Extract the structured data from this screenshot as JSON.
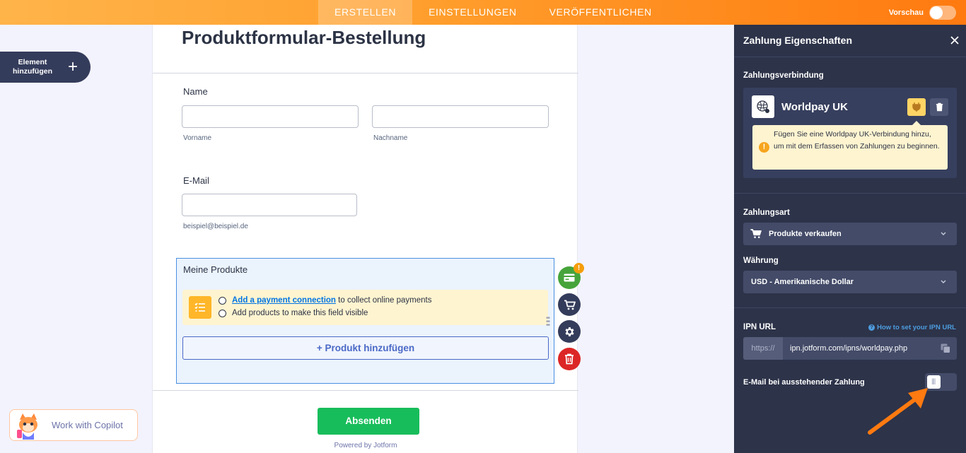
{
  "topbar": {
    "tabs": [
      {
        "label": "ERSTELLEN",
        "active": true
      },
      {
        "label": "EINSTELLUNGEN",
        "active": false
      },
      {
        "label": "VERÖFFENTLICHEN",
        "active": false
      }
    ],
    "preview_label": "Vorschau"
  },
  "sidebar": {
    "add_element_label": "Element hinzufügen"
  },
  "form": {
    "title": "Produktformular-Bestellung",
    "name_label": "Name",
    "firstname_sublabel": "Vorname",
    "lastname_sublabel": "Nachname",
    "email_label": "E-Mail",
    "email_sublabel": "beispiel@beispiel.de",
    "products": {
      "title": "Meine Produkte",
      "notice_link": "Add a payment connection",
      "notice_line1_rest": " to collect online payments",
      "notice_line2": "Add products to make this field visible",
      "add_button": "+ Produkt hinzufügen",
      "badge": "!"
    },
    "submit_label": "Absenden",
    "powered_by": "Powered by Jotform"
  },
  "copilot": {
    "label": "Work with Copilot"
  },
  "panel": {
    "title": "Zahlung Eigenschaften",
    "connection_label": "Zahlungsverbindung",
    "gateway_name": "Worldpay UK",
    "warning_text": "Fügen Sie eine Worldpay UK-Verbindung hinzu, um mit dem Erfassen von Zahlungen zu beginnen.",
    "payment_type_label": "Zahlungsart",
    "payment_type_value": "Produkte verkaufen",
    "currency_label": "Währung",
    "currency_value": "USD - Amerikanische Dollar",
    "ipn_label": "IPN URL",
    "ipn_help": "How to set your IPN URL",
    "ipn_prefix": "https://",
    "ipn_url": "ipn.jotform.com/ipns/worldpay.php",
    "email_pending_label": "E-Mail bei ausstehender Zahlung",
    "email_pending_on": false
  },
  "colors": {
    "accent_orange": "#ff7a10",
    "panel_bg": "#2d3349",
    "submit_green": "#18bd5b",
    "link_blue": "#0075e3"
  }
}
